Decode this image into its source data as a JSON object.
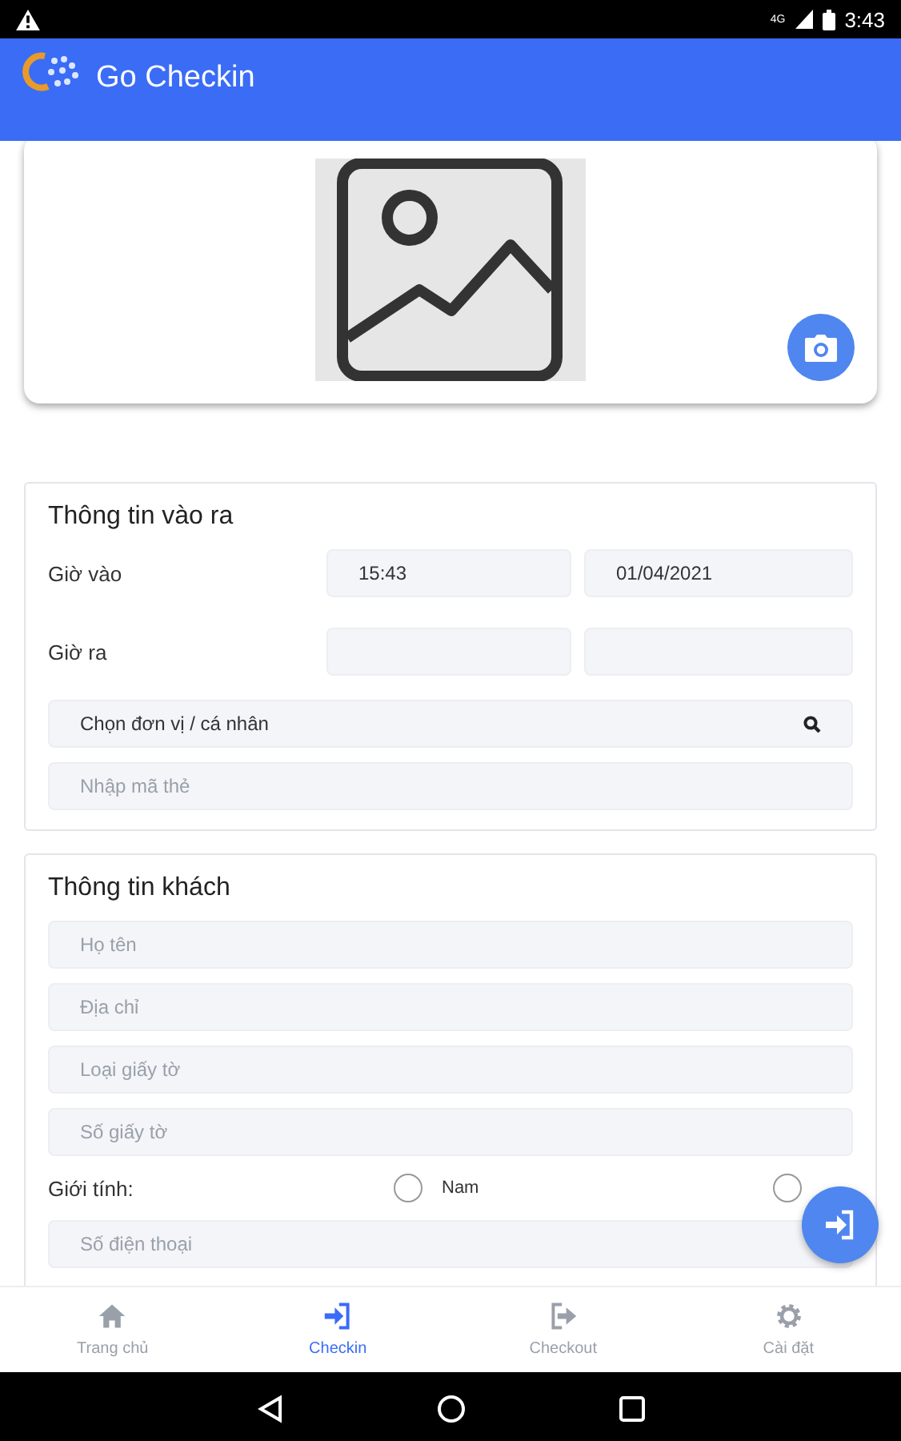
{
  "status_bar": {
    "time": "3:43",
    "network": "4G"
  },
  "app_bar": {
    "title": "Go Checkin"
  },
  "entry_section": {
    "title": "Thông tin vào ra",
    "rows": [
      {
        "label": "Giờ vào",
        "time": "15:43",
        "date": "01/04/2021"
      },
      {
        "label": "Giờ ra"
      }
    ],
    "unit_select": {
      "value": "Chọn đơn vị / cá nhân"
    },
    "card_code": {
      "placeholder": "Nhập mã thẻ"
    }
  },
  "guest_section": {
    "title": "Thông tin khách",
    "fields": [
      {
        "placeholder": "Họ tên"
      },
      {
        "placeholder": "Địa chỉ"
      },
      {
        "placeholder": "Loại giấy tờ"
      },
      {
        "placeholder": "Số giấy tờ"
      }
    ],
    "gender": {
      "label": "Giới tính:",
      "options": [
        {
          "label": "Nam",
          "selected": false
        },
        {
          "selected": false
        }
      ]
    },
    "phone": {
      "placeholder": "Số điện thoại"
    }
  },
  "bottom_nav": [
    {
      "label": "Trang chủ",
      "selected": false
    },
    {
      "label": "Checkin",
      "selected": true
    },
    {
      "label": "Checkout",
      "selected": false
    },
    {
      "label": "Cài đặt",
      "selected": false
    }
  ]
}
